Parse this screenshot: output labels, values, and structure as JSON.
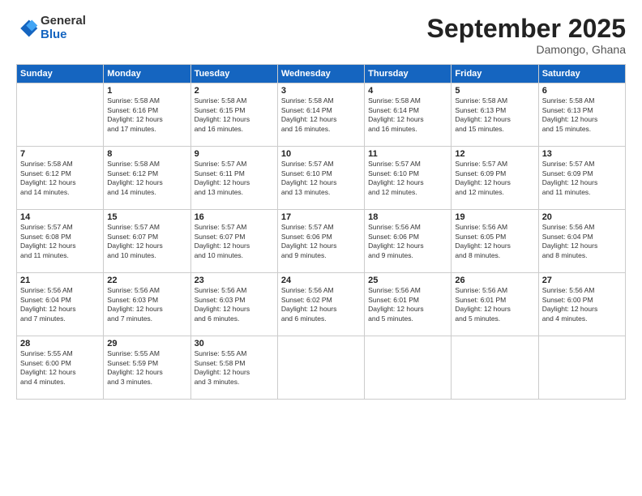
{
  "logo": {
    "general": "General",
    "blue": "Blue"
  },
  "header": {
    "month": "September 2025",
    "location": "Damongo, Ghana"
  },
  "weekdays": [
    "Sunday",
    "Monday",
    "Tuesday",
    "Wednesday",
    "Thursday",
    "Friday",
    "Saturday"
  ],
  "weeks": [
    [
      {
        "day": "",
        "info": ""
      },
      {
        "day": "1",
        "info": "Sunrise: 5:58 AM\nSunset: 6:16 PM\nDaylight: 12 hours\nand 17 minutes."
      },
      {
        "day": "2",
        "info": "Sunrise: 5:58 AM\nSunset: 6:15 PM\nDaylight: 12 hours\nand 16 minutes."
      },
      {
        "day": "3",
        "info": "Sunrise: 5:58 AM\nSunset: 6:14 PM\nDaylight: 12 hours\nand 16 minutes."
      },
      {
        "day": "4",
        "info": "Sunrise: 5:58 AM\nSunset: 6:14 PM\nDaylight: 12 hours\nand 16 minutes."
      },
      {
        "day": "5",
        "info": "Sunrise: 5:58 AM\nSunset: 6:13 PM\nDaylight: 12 hours\nand 15 minutes."
      },
      {
        "day": "6",
        "info": "Sunrise: 5:58 AM\nSunset: 6:13 PM\nDaylight: 12 hours\nand 15 minutes."
      }
    ],
    [
      {
        "day": "7",
        "info": "Sunrise: 5:58 AM\nSunset: 6:12 PM\nDaylight: 12 hours\nand 14 minutes."
      },
      {
        "day": "8",
        "info": "Sunrise: 5:58 AM\nSunset: 6:12 PM\nDaylight: 12 hours\nand 14 minutes."
      },
      {
        "day": "9",
        "info": "Sunrise: 5:57 AM\nSunset: 6:11 PM\nDaylight: 12 hours\nand 13 minutes."
      },
      {
        "day": "10",
        "info": "Sunrise: 5:57 AM\nSunset: 6:10 PM\nDaylight: 12 hours\nand 13 minutes."
      },
      {
        "day": "11",
        "info": "Sunrise: 5:57 AM\nSunset: 6:10 PM\nDaylight: 12 hours\nand 12 minutes."
      },
      {
        "day": "12",
        "info": "Sunrise: 5:57 AM\nSunset: 6:09 PM\nDaylight: 12 hours\nand 12 minutes."
      },
      {
        "day": "13",
        "info": "Sunrise: 5:57 AM\nSunset: 6:09 PM\nDaylight: 12 hours\nand 11 minutes."
      }
    ],
    [
      {
        "day": "14",
        "info": "Sunrise: 5:57 AM\nSunset: 6:08 PM\nDaylight: 12 hours\nand 11 minutes."
      },
      {
        "day": "15",
        "info": "Sunrise: 5:57 AM\nSunset: 6:07 PM\nDaylight: 12 hours\nand 10 minutes."
      },
      {
        "day": "16",
        "info": "Sunrise: 5:57 AM\nSunset: 6:07 PM\nDaylight: 12 hours\nand 10 minutes."
      },
      {
        "day": "17",
        "info": "Sunrise: 5:57 AM\nSunset: 6:06 PM\nDaylight: 12 hours\nand 9 minutes."
      },
      {
        "day": "18",
        "info": "Sunrise: 5:56 AM\nSunset: 6:06 PM\nDaylight: 12 hours\nand 9 minutes."
      },
      {
        "day": "19",
        "info": "Sunrise: 5:56 AM\nSunset: 6:05 PM\nDaylight: 12 hours\nand 8 minutes."
      },
      {
        "day": "20",
        "info": "Sunrise: 5:56 AM\nSunset: 6:04 PM\nDaylight: 12 hours\nand 8 minutes."
      }
    ],
    [
      {
        "day": "21",
        "info": "Sunrise: 5:56 AM\nSunset: 6:04 PM\nDaylight: 12 hours\nand 7 minutes."
      },
      {
        "day": "22",
        "info": "Sunrise: 5:56 AM\nSunset: 6:03 PM\nDaylight: 12 hours\nand 7 minutes."
      },
      {
        "day": "23",
        "info": "Sunrise: 5:56 AM\nSunset: 6:03 PM\nDaylight: 12 hours\nand 6 minutes."
      },
      {
        "day": "24",
        "info": "Sunrise: 5:56 AM\nSunset: 6:02 PM\nDaylight: 12 hours\nand 6 minutes."
      },
      {
        "day": "25",
        "info": "Sunrise: 5:56 AM\nSunset: 6:01 PM\nDaylight: 12 hours\nand 5 minutes."
      },
      {
        "day": "26",
        "info": "Sunrise: 5:56 AM\nSunset: 6:01 PM\nDaylight: 12 hours\nand 5 minutes."
      },
      {
        "day": "27",
        "info": "Sunrise: 5:56 AM\nSunset: 6:00 PM\nDaylight: 12 hours\nand 4 minutes."
      }
    ],
    [
      {
        "day": "28",
        "info": "Sunrise: 5:55 AM\nSunset: 6:00 PM\nDaylight: 12 hours\nand 4 minutes."
      },
      {
        "day": "29",
        "info": "Sunrise: 5:55 AM\nSunset: 5:59 PM\nDaylight: 12 hours\nand 3 minutes."
      },
      {
        "day": "30",
        "info": "Sunrise: 5:55 AM\nSunset: 5:58 PM\nDaylight: 12 hours\nand 3 minutes."
      },
      {
        "day": "",
        "info": ""
      },
      {
        "day": "",
        "info": ""
      },
      {
        "day": "",
        "info": ""
      },
      {
        "day": "",
        "info": ""
      }
    ]
  ]
}
